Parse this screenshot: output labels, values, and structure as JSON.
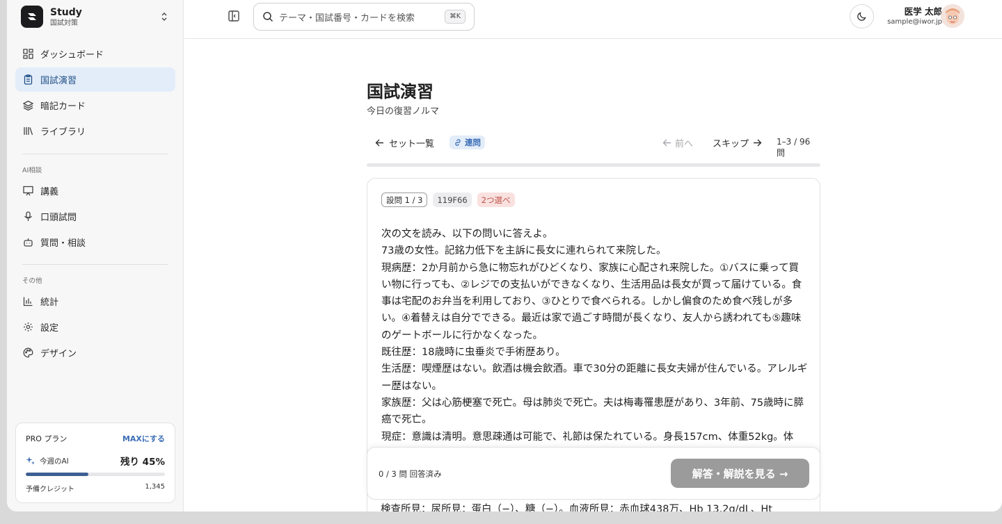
{
  "brand": {
    "name": "Study",
    "sub": "国試対策"
  },
  "nav": {
    "items": [
      {
        "label": "ダッシュボード",
        "icon": "grid-icon"
      },
      {
        "label": "国試演習",
        "icon": "clipboard-icon",
        "active": true
      },
      {
        "label": "暗記カード",
        "icon": "layers-icon"
      },
      {
        "label": "ライブラリ",
        "icon": "library-icon"
      }
    ],
    "ai_section": "AI相談",
    "ai_items": [
      {
        "label": "講義",
        "icon": "presentation-icon"
      },
      {
        "label": "口頭試問",
        "icon": "mic-icon"
      },
      {
        "label": "質問・相談",
        "icon": "bot-icon"
      }
    ],
    "other_section": "その他",
    "other_items": [
      {
        "label": "統計",
        "icon": "chart-icon"
      },
      {
        "label": "設定",
        "icon": "gear-icon"
      },
      {
        "label": "デザイン",
        "icon": "palette-icon"
      }
    ]
  },
  "pro": {
    "plan": "PRO プラン",
    "upgrade": "MAXにする",
    "ai_label": "今週のAI",
    "remaining": "残り 45%",
    "remaining_fraction": 0.45,
    "credit_label": "予備クレジット",
    "credit_value": "1,345"
  },
  "search": {
    "placeholder": "テーマ・国試番号・カードを検索",
    "shortcut": "⌘K"
  },
  "user": {
    "name": "医学 太郎",
    "email": "sample@iwor.jp"
  },
  "page": {
    "title": "国試演習",
    "subtitle": "今日の復習ノルマ",
    "back": "セット一覧",
    "chip": "連問",
    "prev": "前へ",
    "skip": "スキップ",
    "range": "1–3 / 96 問"
  },
  "question": {
    "badges": [
      "設問 1 / 3",
      "119F66",
      "2つ選べ"
    ],
    "paragraphs": [
      "次の文を読み、以下の問いに答えよ。",
      "73歳の女性。記銘力低下を主訴に長女に連れられて来院した。",
      "現病歴：2か月前から急に物忘れがひどくなり、家族に心配され来院した。①バスに乗って買い物に行っても、②レジでの支払いができなくなり、生活用品は長女が買って届けている。食事は宅配のお弁当を利用しており、③ひとりで食べられる。しかし偏食のため食べ残しが多い。④着替えは自分でできる。最近は家で過ごす時間が長くなり、友人から誘われても⑤趣味のゲートボールに行かなくなった。",
      "既往歴：18歳時に虫垂炎で手術歴あり。",
      "生活歴：喫煙歴はない。飲酒は機会飲酒。車で30分の距離に長女夫婦が住んでいる。アレルギー歴はない。",
      "家族歴：父は心筋梗塞で死亡。母は肺炎で死亡。夫は梅毒罹患歴があり、3年前、75歳時に膵癌で死亡。",
      "現症：意識は清明。意思疎通は可能で、礼節は保たれている。身長157cm、体重52kg。体"
    ],
    "tail": "検査所見：尿所見：蛋白（−）、糖（−）。血液所見：赤血球438万、Hb 13.2g/dL、Ht"
  },
  "footer": {
    "answered": "0 / 3 問 回答済み",
    "answer_button": "解答・解説を見る →"
  }
}
